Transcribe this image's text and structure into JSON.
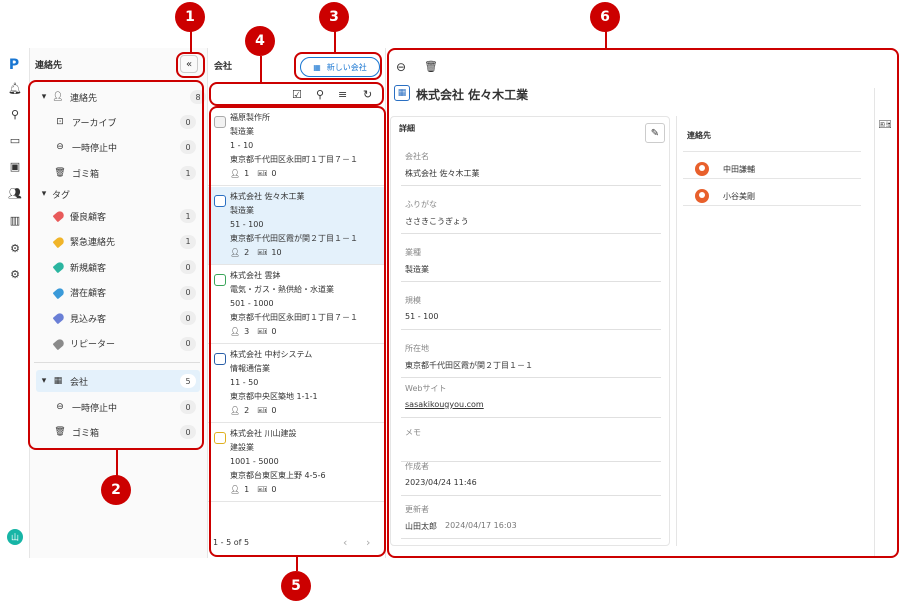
{
  "sidebar": {
    "title": "連絡先",
    "contacts": {
      "label": "連絡先",
      "count": "8"
    },
    "archive": {
      "label": "アーカイブ",
      "count": "0"
    },
    "paused": {
      "label": "一時停止中",
      "count": "0"
    },
    "trash": {
      "label": "ゴミ箱",
      "count": "1"
    },
    "tags_label": "タグ",
    "tags": [
      {
        "label": "優良顧客",
        "count": "1",
        "color": "#e85a5a"
      },
      {
        "label": "緊急連絡先",
        "count": "1",
        "color": "#f0b429"
      },
      {
        "label": "新規顧客",
        "count": "0",
        "color": "#2bb5a0"
      },
      {
        "label": "潜在顧客",
        "count": "0",
        "color": "#3a9ad9"
      },
      {
        "label": "見込み客",
        "count": "0",
        "color": "#6a7fd6"
      },
      {
        "label": "リピーター",
        "count": "0",
        "color": "#8a8a8a"
      }
    ],
    "company": {
      "label": "会社",
      "count": "5"
    },
    "company_paused": {
      "label": "一時停止中",
      "count": "0"
    },
    "company_trash": {
      "label": "ゴミ箱",
      "count": "0"
    },
    "avatar": "山"
  },
  "list": {
    "title": "会社",
    "new_button": "新しい会社",
    "pagination": "1 - 5 of 5",
    "companies": [
      {
        "name": "福原製作所",
        "industry": "製造業",
        "size": "1 - 10",
        "address": "東京都千代田区永田町１丁目７－１",
        "contacts": "1",
        "deals": "0",
        "color": "#aaaaaa"
      },
      {
        "name": "株式会社 佐々木工業",
        "industry": "製造業",
        "size": "51 - 100",
        "address": "東京都千代田区霞が関２丁目１－１",
        "contacts": "2",
        "deals": "10",
        "color": "#2a6fc2"
      },
      {
        "name": "株式会社 雲鉢",
        "industry": "電気・ガス・熱供給・水道業",
        "size": "501 - 1000",
        "address": "東京都千代田区永田町１丁目７－１",
        "contacts": "3",
        "deals": "0",
        "color": "#3aa55a"
      },
      {
        "name": "株式会社 中村システム",
        "industry": "情報通信業",
        "size": "11 - 50",
        "address": "東京都中央区築地 1-1-1",
        "contacts": "2",
        "deals": "0",
        "color": "#2a5fa8"
      },
      {
        "name": "株式会社 川山建設",
        "industry": "建設業",
        "size": "1001 - 5000",
        "address": "東京都台東区東上野 4-5-6",
        "contacts": "1",
        "deals": "0",
        "color": "#e0b020"
      }
    ]
  },
  "detail": {
    "title": "株式会社 佐々木工業",
    "section": "詳細",
    "fields": [
      {
        "label": "会社名",
        "value": "株式会社 佐々木工業"
      },
      {
        "label": "ふりがな",
        "value": "ささきこうぎょう"
      },
      {
        "label": "業種",
        "value": "製造業"
      },
      {
        "label": "規模",
        "value": "51 - 100"
      },
      {
        "label": "所在地",
        "value": "東京都千代田区霞が関２丁目１－１"
      },
      {
        "label": "Webサイト",
        "value": "sasakikougyou.com"
      },
      {
        "label": "メモ",
        "value": ""
      },
      {
        "label": "作成者",
        "value": "2023/04/24 11:46"
      },
      {
        "label": "更新者",
        "value": "山田太郎",
        "extra": "2024/04/17 16:03"
      }
    ],
    "contacts_title": "連絡先",
    "contacts": [
      "中田謙輔",
      "小谷美剛"
    ]
  },
  "callouts": [
    "1",
    "2",
    "3",
    "4",
    "5",
    "6"
  ]
}
